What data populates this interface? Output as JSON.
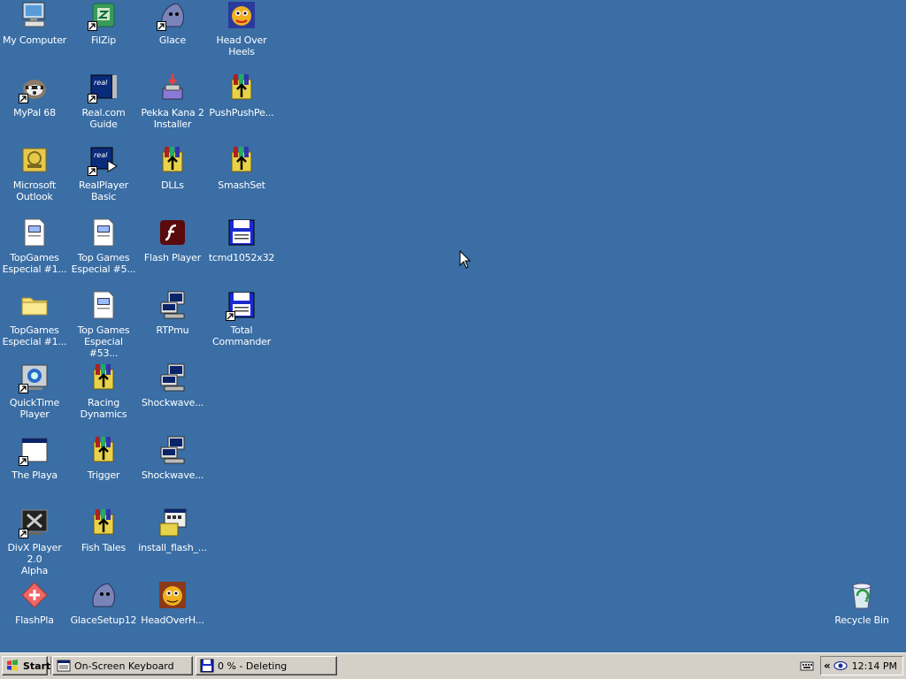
{
  "desktop_icons": [
    {
      "label": "My Computer",
      "icon": "computer-icon"
    },
    {
      "label": "FilZip",
      "icon": "filzip-icon"
    },
    {
      "label": "Glace",
      "icon": "glace-icon"
    },
    {
      "label": "Head Over\nHeels",
      "icon": "head-over-heels-icon"
    },
    {
      "label": "MyPal 68",
      "icon": "mypal-icon"
    },
    {
      "label": "Real.com Guide",
      "icon": "real-guide-icon"
    },
    {
      "label": "Pekka Kana 2\nInstaller",
      "icon": "installer-icon"
    },
    {
      "label": "PushPushPe...",
      "icon": "winrar-archive-icon"
    },
    {
      "label": "Microsoft\nOutlook",
      "icon": "outlook-icon"
    },
    {
      "label": "RealPlayer\nBasic",
      "icon": "realplayer-icon"
    },
    {
      "label": "DLLs",
      "icon": "winrar-archive-icon"
    },
    {
      "label": "SmashSet",
      "icon": "winrar-archive-icon"
    },
    {
      "label": "TopGames\nEspecial #1...",
      "icon": "document-icon"
    },
    {
      "label": "Top Games\nEspecial #5...",
      "icon": "document-icon"
    },
    {
      "label": "Flash Player",
      "icon": "flash-icon"
    },
    {
      "label": "tcmd1052x32",
      "icon": "floppy-icon"
    },
    {
      "label": "TopGames\nEspecial #1...",
      "icon": "folder-icon"
    },
    {
      "label": "Top Games\nEspecial #53...",
      "icon": "document-icon"
    },
    {
      "label": "RTPmu",
      "icon": "setup-icon"
    },
    {
      "label": "Total\nCommander",
      "icon": "floppy-icon"
    },
    {
      "label": "QuickTime\nPlayer",
      "icon": "quicktime-icon"
    },
    {
      "label": "Racing\nDynamics",
      "icon": "winrar-archive-icon"
    },
    {
      "label": "Shockwave...",
      "icon": "setup-icon"
    },
    {
      "label": "The Playa",
      "icon": "window-icon"
    },
    {
      "label": "Trigger",
      "icon": "winrar-archive-icon"
    },
    {
      "label": "Shockwave...",
      "icon": "setup-icon"
    },
    {
      "label": "DivX Player 2.0\nAlpha",
      "icon": "divx-icon"
    },
    {
      "label": "Fish Tales",
      "icon": "winrar-archive-icon"
    },
    {
      "label": "install_flash_...",
      "icon": "setup-window-icon"
    },
    {
      "label": "FlashPla",
      "icon": "flashpla-icon"
    },
    {
      "label": "GlaceSetup12",
      "icon": "glace-icon"
    },
    {
      "label": "HeadOverH...",
      "icon": "head-over-heels-icon"
    },
    {
      "label": "Recycle Bin",
      "icon": "recycle-bin-icon"
    }
  ],
  "taskbar": {
    "start_label": "Start",
    "tasks": [
      {
        "label": "On-Screen Keyboard",
        "icon": "keyboard-window-icon"
      },
      {
        "label": "0 % - Deleting",
        "icon": "floppy-icon"
      }
    ],
    "clock": "12:14 PM",
    "tray_chevron": "«"
  },
  "colors": {
    "desktop": "#3a6ea5",
    "taskbar": "#d4d0c8"
  }
}
